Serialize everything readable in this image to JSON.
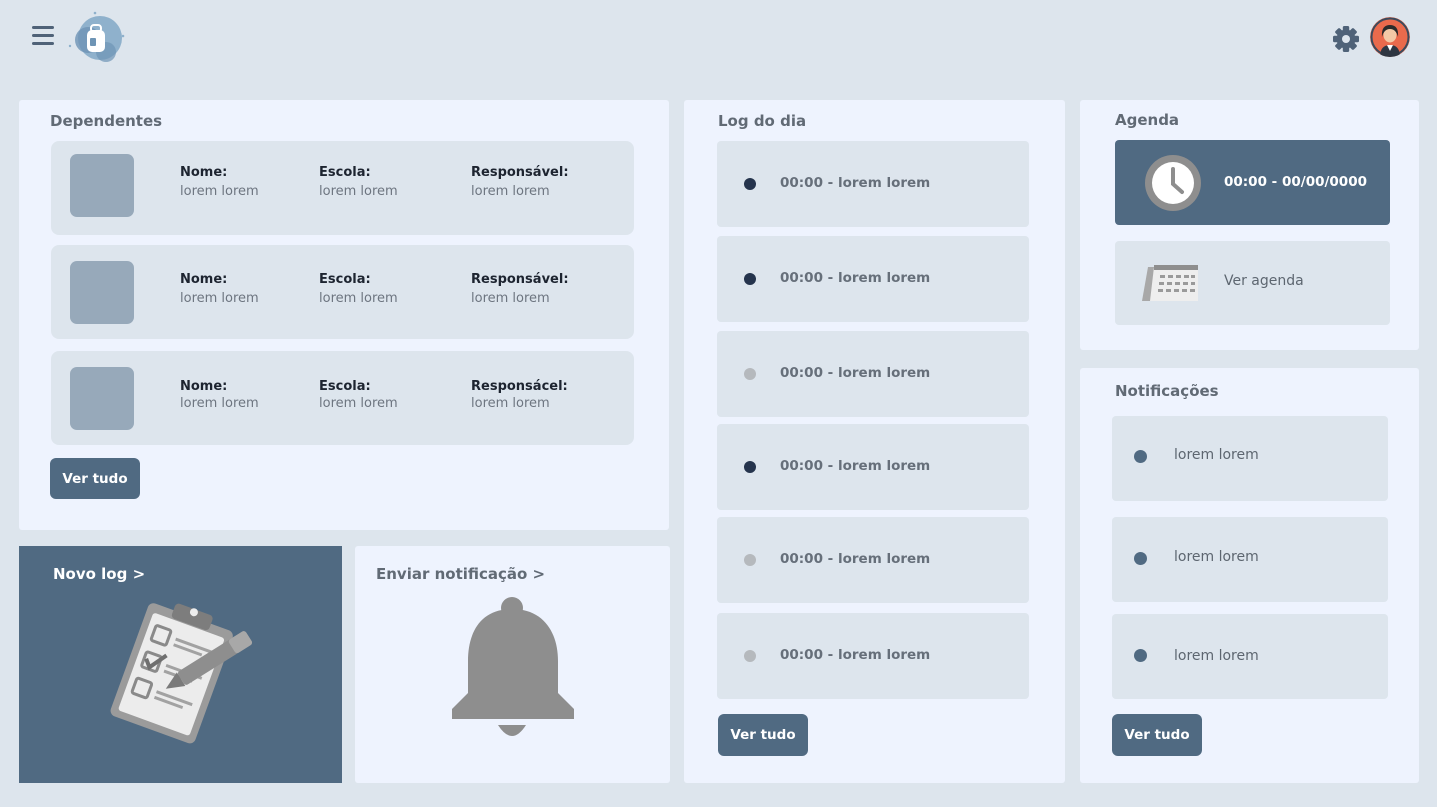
{
  "header": {
    "menu_icon": "hamburger-menu-icon",
    "settings_icon": "gear-icon"
  },
  "dependents": {
    "title": "Dependentes",
    "items": [
      {
        "name_label": "Nome:",
        "name_value": "lorem lorem",
        "school_label": "Escola:",
        "school_value": "lorem lorem",
        "guardian_label": "Responsável:",
        "guardian_value": "lorem lorem"
      },
      {
        "name_label": "Nome:",
        "name_value": "lorem lorem",
        "school_label": "Escola:",
        "school_value": "lorem lorem",
        "guardian_label": "Responsável:",
        "guardian_value": "lorem lorem"
      },
      {
        "name_label": "Nome:",
        "name_value": "lorem lorem",
        "school_label": "Escola:",
        "school_value": "lorem lorem",
        "guardian_label": "Responsácel:",
        "guardian_value": "lorem lorem"
      }
    ],
    "see_all_label": "Ver tudo"
  },
  "new_log": {
    "label": "Novo log >"
  },
  "send_notification": {
    "label": "Enviar notificação >"
  },
  "daily_log": {
    "title": "Log do dia",
    "items": [
      {
        "text": "00:00 - lorem lorem",
        "dot_color": "#25344d"
      },
      {
        "text": "00:00 - lorem lorem",
        "dot_color": "#25344d"
      },
      {
        "text": "00:00 - lorem lorem",
        "dot_color": "#b5b9bd"
      },
      {
        "text": "00:00 - lorem lorem",
        "dot_color": "#25344d"
      },
      {
        "text": "00:00 - lorem lorem",
        "dot_color": "#b5b9bd"
      },
      {
        "text": "00:00 - lorem lorem",
        "dot_color": "#b5b9bd"
      }
    ],
    "see_all_label": "Ver tudo"
  },
  "agenda": {
    "title": "Agenda",
    "next_event": "00:00 - 00/00/0000",
    "view_label": "Ver agenda"
  },
  "notifications": {
    "title": "Notificações",
    "items": [
      {
        "text": "lorem lorem"
      },
      {
        "text": "lorem lorem"
      },
      {
        "text": "lorem lorem"
      }
    ],
    "see_all_label": "Ver tudo"
  },
  "colors": {
    "background": "#dde5ed",
    "panel": "#eef3fe",
    "accent": "#506a82",
    "dark_dot": "#25344d",
    "light_dot": "#b5b9bd"
  }
}
